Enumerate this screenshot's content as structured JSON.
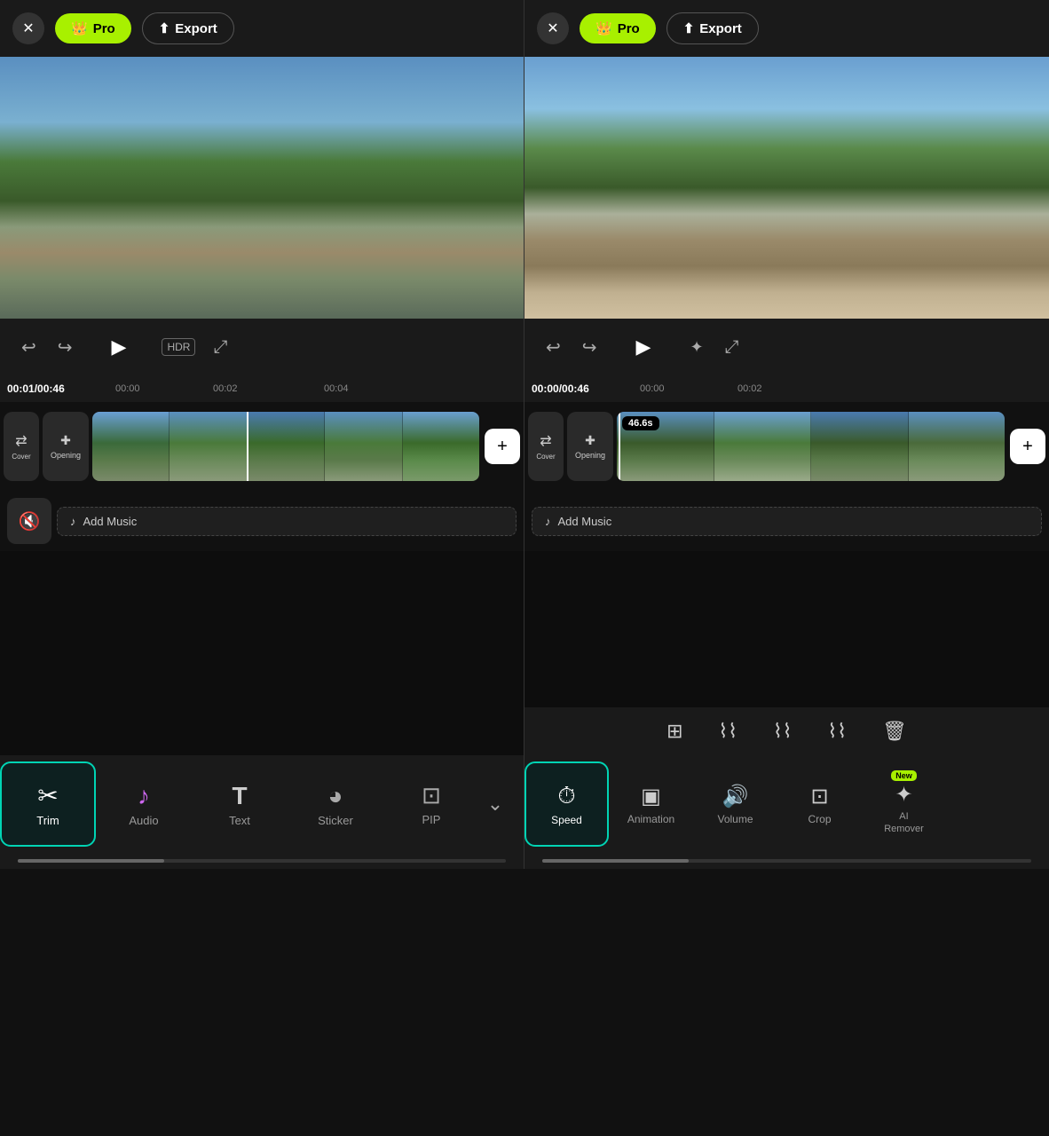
{
  "left": {
    "close_label": "✕",
    "pro_label": "Pro",
    "export_label": "Export",
    "crown": "👑",
    "timecode_current": "00:01",
    "timecode_total": "00:46",
    "ruler_times": [
      "00:00",
      "00:02",
      "00:04"
    ],
    "cover_label": "Cover",
    "opening_label": "Opening",
    "add_music_label": "Add Music",
    "add_clip_label": "+",
    "tools": [
      {
        "id": "trim",
        "label": "Trim",
        "icon": "✂",
        "active": true
      },
      {
        "id": "audio",
        "label": "Audio",
        "icon": "♪",
        "active": false
      },
      {
        "id": "text",
        "label": "Text",
        "icon": "T",
        "active": false
      },
      {
        "id": "sticker",
        "label": "Sticker",
        "icon": "◕",
        "active": false
      },
      {
        "id": "pip",
        "label": "PIP",
        "icon": "⊡",
        "active": false
      }
    ],
    "more_icon": "⌄"
  },
  "right": {
    "close_label": "✕",
    "pro_label": "Pro",
    "export_label": "Export",
    "crown": "👑",
    "timecode_current": "00:00",
    "timecode_total": "00:46",
    "ruler_times": [
      "00:00",
      "00:02"
    ],
    "cover_label": "Cover",
    "opening_label": "Opening",
    "clip_badge": "46.6s",
    "add_music_label": "Add Music",
    "add_clip_label": "+",
    "tools": [
      {
        "id": "speed",
        "label": "Speed",
        "icon": "⏱",
        "active": true
      },
      {
        "id": "animation",
        "label": "Animation",
        "icon": "▣",
        "active": false
      },
      {
        "id": "volume",
        "label": "Volume",
        "icon": "🔊",
        "active": false
      },
      {
        "id": "crop",
        "label": "Crop",
        "icon": "⊡",
        "active": false
      },
      {
        "id": "ai-remover",
        "label": "AI\nRemover",
        "icon": "✦",
        "active": false,
        "badge": "New"
      }
    ],
    "edit_icons": [
      "⊞",
      "⌇",
      "⌇",
      "⌇",
      "🗑"
    ]
  }
}
